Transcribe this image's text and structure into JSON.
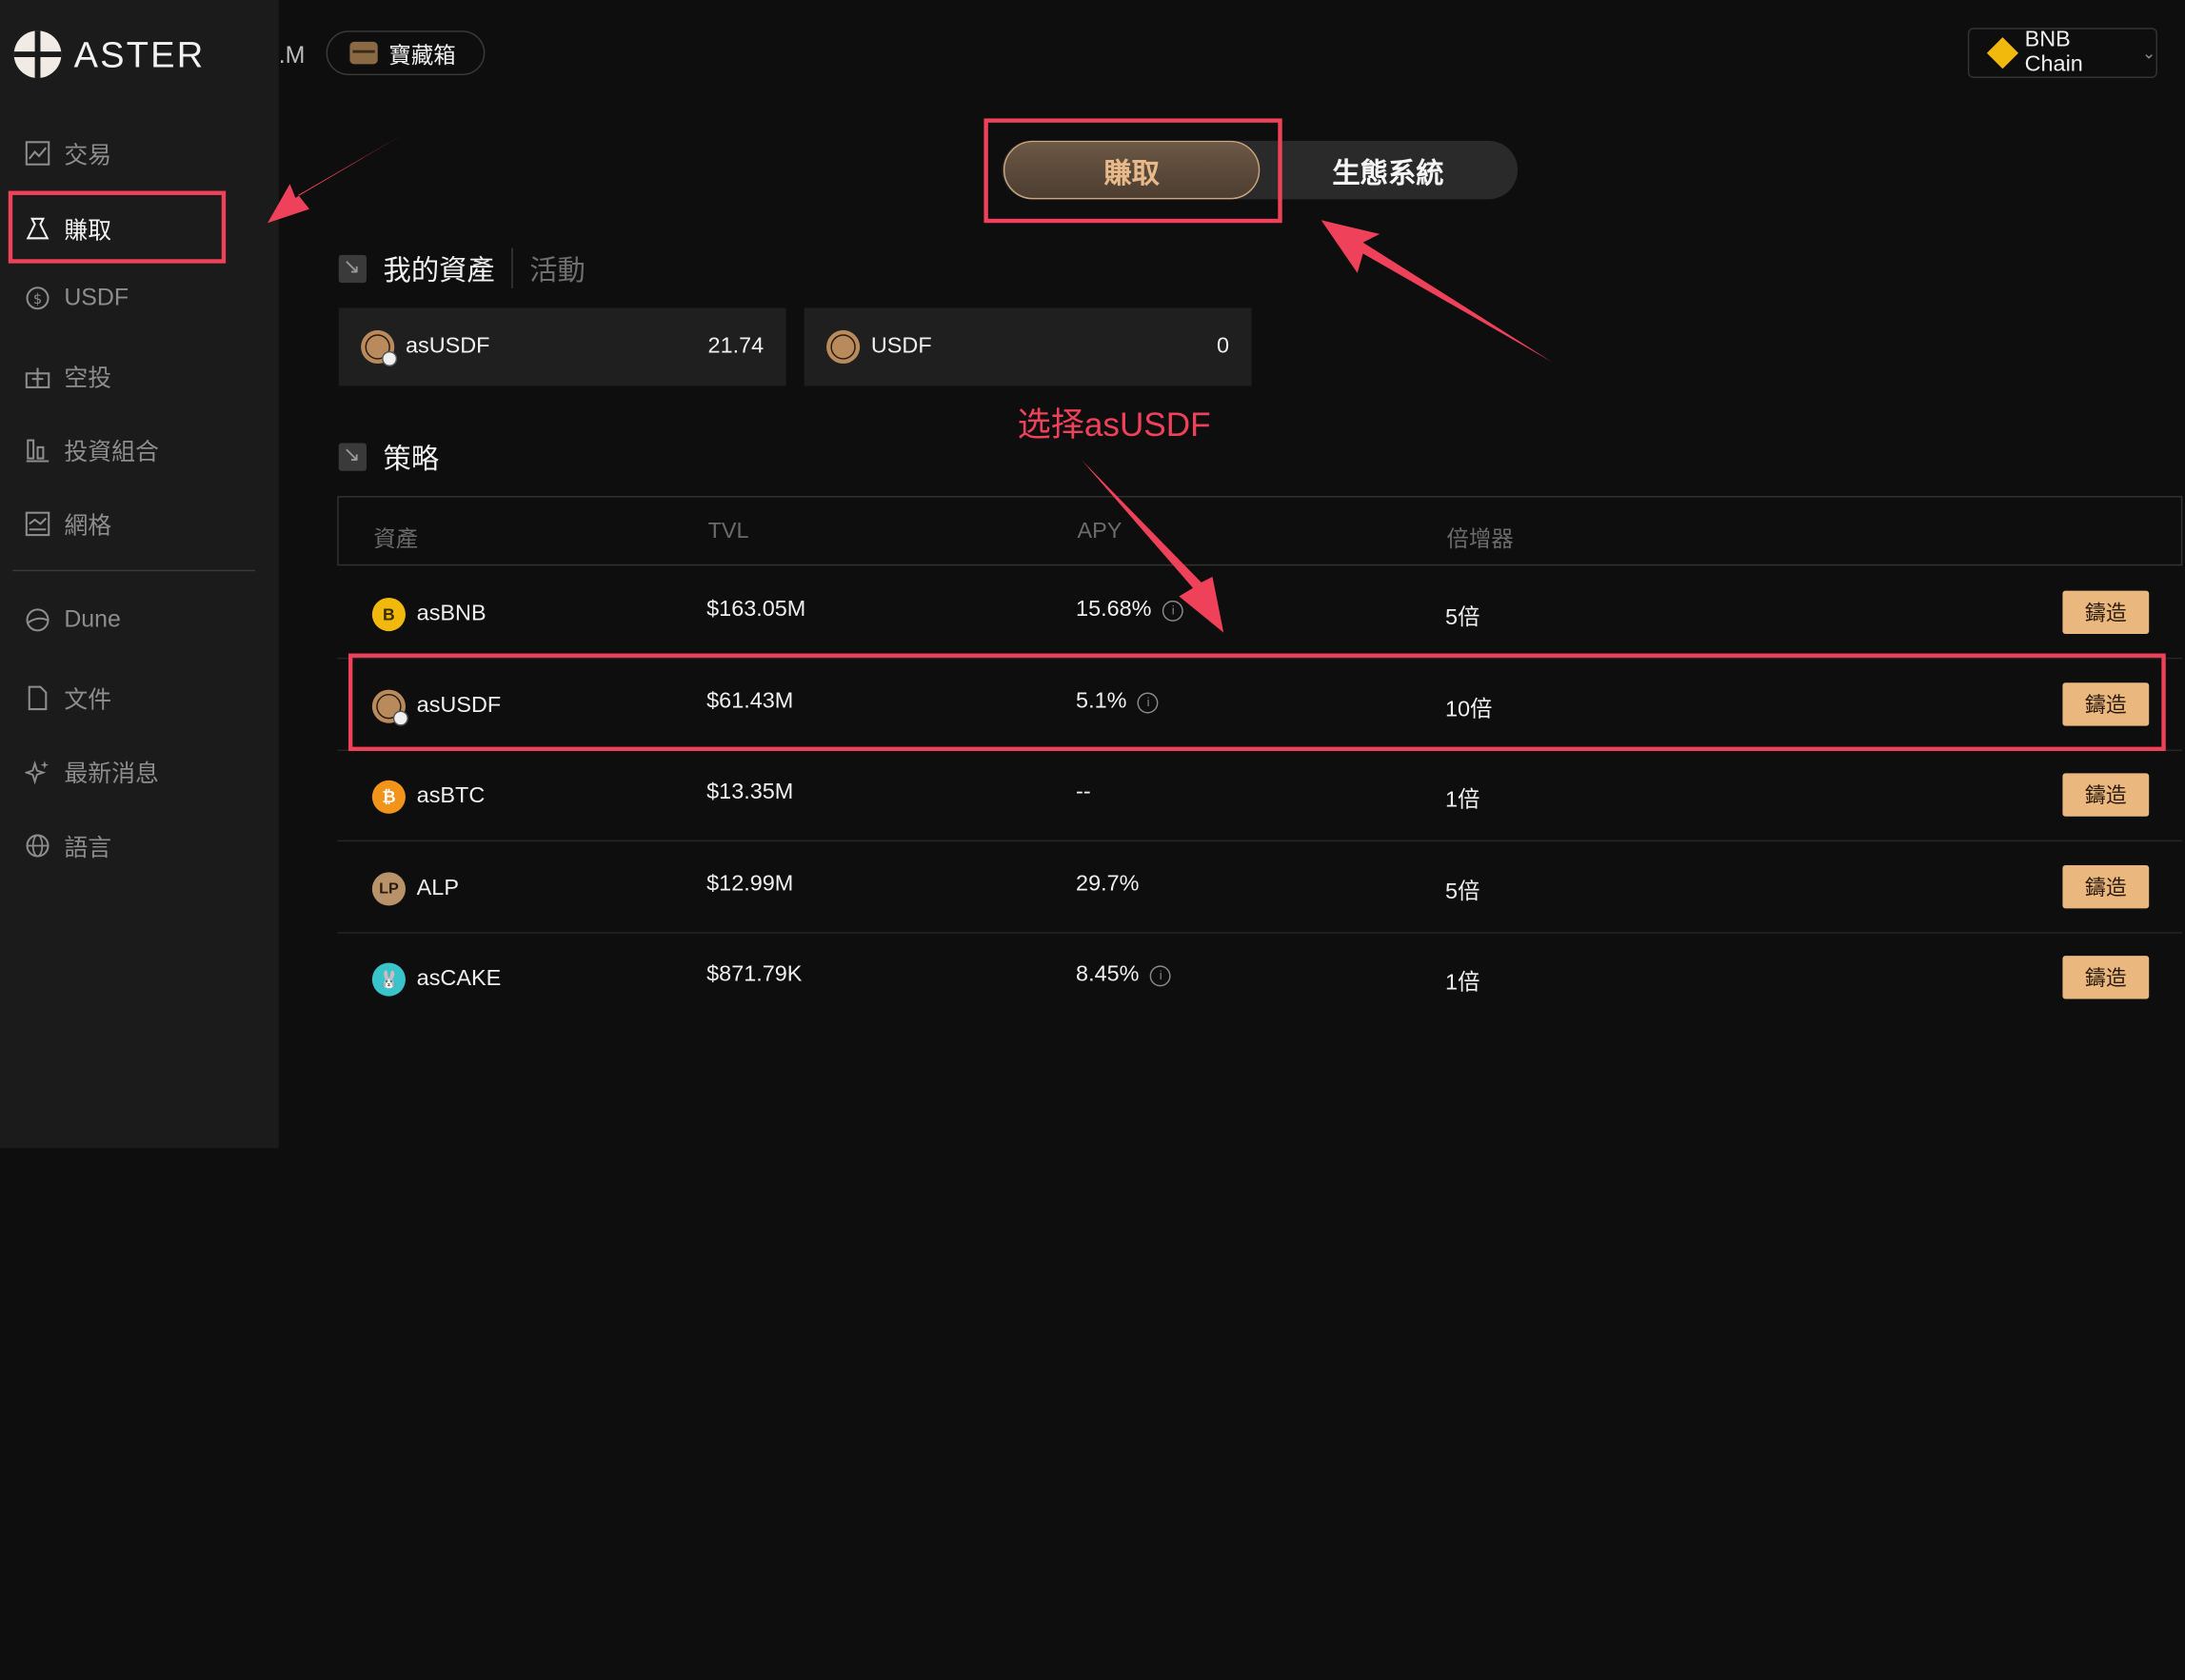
{
  "brand": {
    "name": "ASTER"
  },
  "topbar": {
    "partial_tab": ".M",
    "treasure_label": "寶藏箱",
    "chain_label": "BNB Chain",
    "chain_chevron": "⌄"
  },
  "sidebar": {
    "items": [
      {
        "label": "交易",
        "icon": "chart-icon",
        "glyph": "📈"
      },
      {
        "label": "賺取",
        "icon": "earn-icon",
        "glyph": "⧗"
      },
      {
        "label": "USDF",
        "icon": "dollar-coin-icon",
        "glyph": "$"
      },
      {
        "label": "空投",
        "icon": "airdrop-icon",
        "glyph": "⊞"
      },
      {
        "label": "投資組合",
        "icon": "portfolio-icon",
        "glyph": "▥"
      },
      {
        "label": "網格",
        "icon": "grid-icon",
        "glyph": "▦"
      },
      {
        "label": "Dune",
        "icon": "dune-icon",
        "glyph": "◐"
      },
      {
        "label": "文件",
        "icon": "document-icon",
        "glyph": "▯"
      },
      {
        "label": "最新消息",
        "icon": "sparkle-icon",
        "glyph": "✧"
      },
      {
        "label": "語言",
        "icon": "globe-icon",
        "glyph": "⊕"
      }
    ]
  },
  "tabs": {
    "earn": "賺取",
    "ecosystem": "生態系統"
  },
  "assets_section": {
    "title": "我的資產",
    "subtitle": "活動"
  },
  "asset_cards": [
    {
      "name": "asUSDF",
      "value": "21.74",
      "icon": "usdf-coin-icon"
    },
    {
      "name": "USDF",
      "value": "0",
      "icon": "usdf-coin-icon"
    }
  ],
  "annotation": {
    "text": "选择asUSDF"
  },
  "strategy_section": {
    "title": "策略"
  },
  "table": {
    "headers": [
      "資產",
      "TVL",
      "APY",
      "倍增器"
    ],
    "info_glyph": "i",
    "rows": [
      {
        "asset": "asBNB",
        "coin": "B",
        "tvl": "$163.05M",
        "apy": "15.68%",
        "apy_info": true,
        "multiplier": "5倍",
        "action": "鑄造"
      },
      {
        "asset": "asUSDF",
        "coin": "$",
        "tvl": "$61.43M",
        "apy": "5.1%",
        "apy_info": true,
        "multiplier": "10倍",
        "action": "鑄造"
      },
      {
        "asset": "asBTC",
        "coin": "₿",
        "tvl": "$13.35M",
        "apy": "--",
        "apy_info": false,
        "multiplier": "1倍",
        "action": "鑄造"
      },
      {
        "asset": "ALP",
        "coin": "LP",
        "tvl": "$12.99M",
        "apy": "29.7%",
        "apy_info": false,
        "multiplier": "5倍",
        "action": "鑄造"
      },
      {
        "asset": "asCAKE",
        "coin": "🐰",
        "tvl": "$871.79K",
        "apy": "8.45%",
        "apy_info": true,
        "multiplier": "1倍",
        "action": "鑄造"
      }
    ]
  },
  "colors": {
    "accent": "#eab77f",
    "highlight": "#f0415a",
    "sidebar_bg": "#1b1b1b",
    "page_bg": "#0e0e0e"
  }
}
